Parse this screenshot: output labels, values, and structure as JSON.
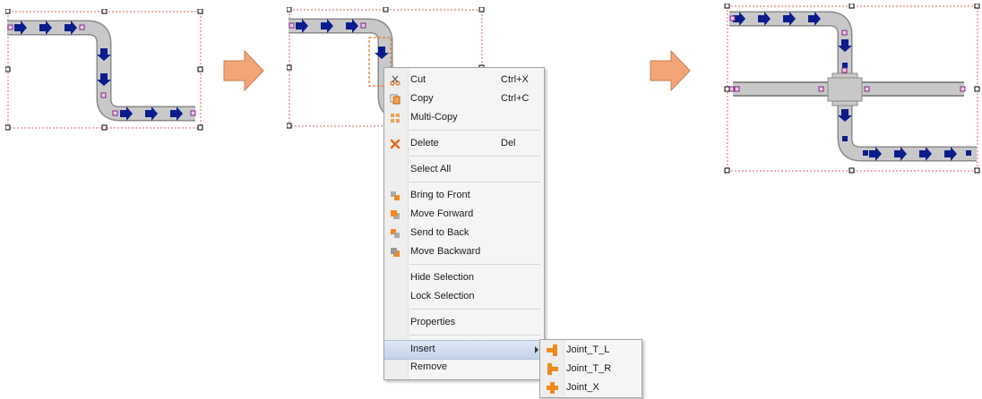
{
  "context_menu": {
    "items": [
      {
        "label": "Cut",
        "shortcut": "Ctrl+X",
        "icon": "scissors-icon"
      },
      {
        "label": "Copy",
        "shortcut": "Ctrl+C",
        "icon": "copy-icon"
      },
      {
        "label": "Multi-Copy",
        "shortcut": "",
        "icon": "multi-copy-icon"
      },
      {
        "label": "Delete",
        "shortcut": "Del",
        "icon": "delete-x-icon"
      },
      {
        "label": "Select All",
        "shortcut": "",
        "icon": ""
      },
      {
        "label": "Bring to Front",
        "shortcut": "",
        "icon": "bring-to-front-icon"
      },
      {
        "label": "Move Forward",
        "shortcut": "",
        "icon": "move-forward-icon"
      },
      {
        "label": "Send to Back",
        "shortcut": "",
        "icon": "send-to-back-icon"
      },
      {
        "label": "Move Backward",
        "shortcut": "",
        "icon": "move-backward-icon"
      },
      {
        "label": "Hide Selection",
        "shortcut": "",
        "icon": ""
      },
      {
        "label": "Lock Selection",
        "shortcut": "",
        "icon": ""
      },
      {
        "label": "Properties",
        "shortcut": "",
        "icon": ""
      },
      {
        "label": "Insert",
        "shortcut": "",
        "icon": ""
      },
      {
        "label": "Remove",
        "shortcut": "",
        "icon": ""
      }
    ]
  },
  "insert_submenu": {
    "items": [
      {
        "label": "Joint_T_L",
        "icon": "joint-t-left-icon"
      },
      {
        "label": "Joint_T_R",
        "icon": "joint-t-right-icon"
      },
      {
        "label": "Joint_X",
        "icon": "joint-x-icon"
      }
    ]
  },
  "colors": {
    "pipe": "#c8c8c8",
    "pipe_edge": "#8a8a8a",
    "flow_arrow": "#0b1d8c",
    "step_arrow": "#f2a677",
    "selection_border": "#e08080",
    "menu_icon_orange": "#f08a1e"
  }
}
